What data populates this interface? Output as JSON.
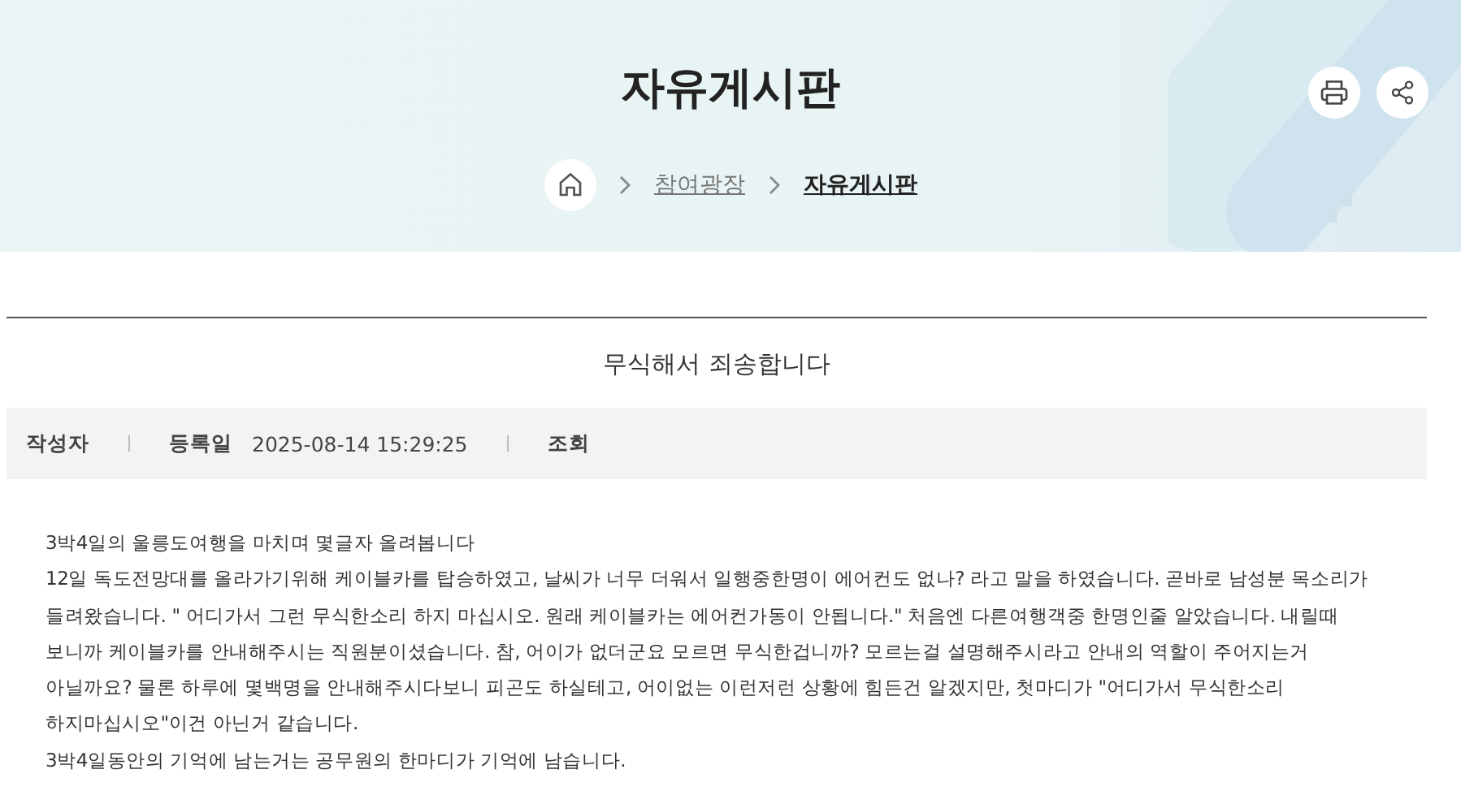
{
  "header": {
    "title": "자유게시판",
    "actions": [
      {
        "kind": "print"
      },
      {
        "kind": "share"
      }
    ]
  },
  "breadcrumb": [
    {
      "kind": "home"
    },
    {
      "kind": "link",
      "label": "참여광장",
      "current": false
    },
    {
      "kind": "link",
      "label": "자유게시판",
      "current": true
    }
  ],
  "post": {
    "title": "무식해서 죄송합니다",
    "meta": [
      {
        "label": "작성자"
      },
      {
        "label": "등록일",
        "value": "2025-08-14 15:29:25"
      },
      {
        "label": "조회"
      }
    ],
    "body": [
      [
        "3박4일의 울릉도여행을 마치며 몇글자 올려봅니다"
      ],
      [
        "12일 독도전망대를 올라가기위해 케이블카를 탑승하였고, 날씨가 너무 더워서 일행중한명이 에어컨도 없나? 라고 말을 하였습니다. 곧바로 남성분 목소리가",
        "들려왔습니다. \" 어디가서 그런 무식한소리 하지 마십시오. 원래 케이블카는 에어컨가동이 안됩니다.\" 처음엔 다른여행객중 한명인줄 알았습니다. 내릴때",
        "보니까 케이블카를 안내해주시는 직원분이셨습니다. 참, 어이가 없더군요 모르면 무식한겁니까? 모르는걸 설명해주시라고 안내의 역할이 주어지는거",
        "아닐까요? 물론 하루에 몇백명을 안내해주시다보니 피곤도 하실테고, 어이없는 이런저런 상황에 힘든건 알겠지만, 첫마디가 \"어디가서 무식한소리",
        "하지마십시오\"이건 아닌거 같습니다."
      ],
      [
        "3박4일동안의 기억에 남는거는 공무원의 한마디가 기억에 남습니다."
      ]
    ]
  }
}
